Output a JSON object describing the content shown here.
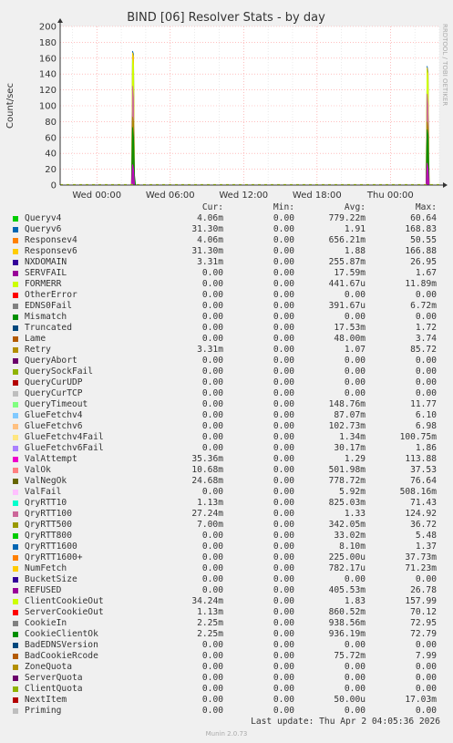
{
  "chart_data": {
    "type": "area",
    "title": "BIND [06] Resolver Stats - by day",
    "ylabel": "Count/sec",
    "side_text": "RRDTOOL / TOBI OETIKER",
    "ylim": [
      0,
      200
    ],
    "yticks": [
      "0",
      "20",
      "40",
      "60",
      "80",
      "100",
      "120",
      "140",
      "160",
      "180",
      "200"
    ],
    "x_range": [
      "2026-03-31 21:00",
      "2026-04-02 04:00"
    ],
    "xticks": [
      {
        "label": "Wed 00:00",
        "time": "2026-04-01 00:00"
      },
      {
        "label": "Wed 06:00",
        "time": "2026-04-01 06:00"
      },
      {
        "label": "Wed 12:00",
        "time": "2026-04-01 12:00"
      },
      {
        "label": "Wed 18:00",
        "time": "2026-04-01 18:00"
      },
      {
        "label": "Thu 00:00",
        "time": "2026-04-02 00:00"
      }
    ],
    "grid": true,
    "series": [
      {
        "name": "Queryv6",
        "color": "#0066b3",
        "points": [
          [
            "2026-04-01 02:50",
            0
          ],
          [
            "2026-04-01 02:55",
            169
          ],
          [
            "2026-04-01 03:00",
            165
          ],
          [
            "2026-04-01 03:05",
            0
          ],
          [
            "2026-04-02 02:55",
            0
          ],
          [
            "2026-04-02 03:00",
            150
          ],
          [
            "2026-04-02 03:05",
            143
          ],
          [
            "2026-04-02 03:10",
            0
          ]
        ]
      },
      {
        "name": "Responsev6",
        "color": "#ffcc00",
        "points": [
          [
            "2026-04-01 02:50",
            0
          ],
          [
            "2026-04-01 02:55",
            167
          ],
          [
            "2026-04-01 03:00",
            162
          ],
          [
            "2026-04-01 03:05",
            0
          ],
          [
            "2026-04-02 02:55",
            0
          ],
          [
            "2026-04-02 03:00",
            148
          ],
          [
            "2026-04-02 03:05",
            140
          ],
          [
            "2026-04-02 03:10",
            0
          ]
        ]
      },
      {
        "name": "ClientCookieOut",
        "color": "#ccff00",
        "points": [
          [
            "2026-04-01 02:50",
            0
          ],
          [
            "2026-04-01 02:55",
            158
          ],
          [
            "2026-04-01 03:00",
            150
          ],
          [
            "2026-04-01 03:05",
            0
          ],
          [
            "2026-04-02 02:55",
            0
          ],
          [
            "2026-04-02 03:00",
            145
          ],
          [
            "2026-04-02 03:05",
            130
          ],
          [
            "2026-04-02 03:10",
            0
          ]
        ]
      },
      {
        "name": "QryRTT100",
        "color": "#cc6699",
        "points": [
          [
            "2026-04-01 02:50",
            0
          ],
          [
            "2026-04-01 02:55",
            125
          ],
          [
            "2026-04-01 03:00",
            110
          ],
          [
            "2026-04-01 03:05",
            0
          ],
          [
            "2026-04-02 02:55",
            0
          ],
          [
            "2026-04-02 03:00",
            115
          ],
          [
            "2026-04-02 03:05",
            100
          ],
          [
            "2026-04-02 03:10",
            0
          ]
        ]
      },
      {
        "name": "Retry",
        "color": "#aa8800",
        "points": [
          [
            "2026-04-01 02:50",
            0
          ],
          [
            "2026-04-01 02:55",
            86
          ],
          [
            "2026-04-01 03:00",
            80
          ],
          [
            "2026-04-01 03:05",
            0
          ],
          [
            "2026-04-02 02:55",
            0
          ],
          [
            "2026-04-02 03:00",
            80
          ],
          [
            "2026-04-02 03:05",
            70
          ],
          [
            "2026-04-02 03:10",
            0
          ]
        ]
      },
      {
        "name": "CookieIn",
        "color": "#008f00",
        "points": [
          [
            "2026-04-01 02:50",
            0
          ],
          [
            "2026-04-01 02:55",
            73
          ],
          [
            "2026-04-01 03:00",
            60
          ],
          [
            "2026-04-01 03:05",
            12
          ],
          [
            "2026-04-01 03:10",
            0
          ],
          [
            "2026-04-02 02:55",
            0
          ],
          [
            "2026-04-02 03:00",
            70
          ],
          [
            "2026-04-02 03:05",
            62
          ],
          [
            "2026-04-02 03:10",
            0
          ]
        ]
      },
      {
        "name": "ValAttempt",
        "color": "#cc00cc",
        "points": [
          [
            "2026-04-01 02:50",
            0
          ],
          [
            "2026-04-01 02:55",
            26
          ],
          [
            "2026-04-01 03:00",
            20
          ],
          [
            "2026-04-01 03:05",
            0
          ],
          [
            "2026-04-02 02:55",
            0
          ],
          [
            "2026-04-02 03:00",
            28
          ],
          [
            "2026-04-02 03:05",
            20
          ],
          [
            "2026-04-02 03:10",
            0
          ]
        ]
      }
    ],
    "legend_columns": [
      "Cur:",
      "Min:",
      "Avg:",
      "Max:"
    ],
    "legend": [
      {
        "name": "Queryv4",
        "color": "#00cc00",
        "cur": "4.06m",
        "min": "0.00",
        "avg": "779.22m",
        "max": "60.64"
      },
      {
        "name": "Queryv6",
        "color": "#0066b3",
        "cur": "31.30m",
        "min": "0.00",
        "avg": "1.91",
        "max": "168.83"
      },
      {
        "name": "Responsev4",
        "color": "#ff8000",
        "cur": "4.06m",
        "min": "0.00",
        "avg": "656.21m",
        "max": "50.55"
      },
      {
        "name": "Responsev6",
        "color": "#ffcc00",
        "cur": "31.30m",
        "min": "0.00",
        "avg": "1.88",
        "max": "166.88"
      },
      {
        "name": "NXDOMAIN",
        "color": "#330099",
        "cur": "3.31m",
        "min": "0.00",
        "avg": "255.87m",
        "max": "26.95"
      },
      {
        "name": "SERVFAIL",
        "color": "#990099",
        "cur": "0.00",
        "min": "0.00",
        "avg": "17.59m",
        "max": "1.67"
      },
      {
        "name": "FORMERR",
        "color": "#ccff00",
        "cur": "0.00",
        "min": "0.00",
        "avg": "441.67u",
        "max": "11.89m"
      },
      {
        "name": "OtherError",
        "color": "#ff0000",
        "cur": "0.00",
        "min": "0.00",
        "avg": "0.00",
        "max": "0.00"
      },
      {
        "name": "EDNS0Fail",
        "color": "#808080",
        "cur": "0.00",
        "min": "0.00",
        "avg": "391.67u",
        "max": "6.72m"
      },
      {
        "name": "Mismatch",
        "color": "#008f00",
        "cur": "0.00",
        "min": "0.00",
        "avg": "0.00",
        "max": "0.00"
      },
      {
        "name": "Truncated",
        "color": "#00487d",
        "cur": "0.00",
        "min": "0.00",
        "avg": "17.53m",
        "max": "1.72"
      },
      {
        "name": "Lame",
        "color": "#b35a00",
        "cur": "0.00",
        "min": "0.00",
        "avg": "48.00m",
        "max": "3.74"
      },
      {
        "name": "Retry",
        "color": "#b38f00",
        "cur": "3.31m",
        "min": "0.00",
        "avg": "1.07",
        "max": "85.72"
      },
      {
        "name": "QueryAbort",
        "color": "#6b006b",
        "cur": "0.00",
        "min": "0.00",
        "avg": "0.00",
        "max": "0.00"
      },
      {
        "name": "QuerySockFail",
        "color": "#8fb300",
        "cur": "0.00",
        "min": "0.00",
        "avg": "0.00",
        "max": "0.00"
      },
      {
        "name": "QueryCurUDP",
        "color": "#b30000",
        "cur": "0.00",
        "min": "0.00",
        "avg": "0.00",
        "max": "0.00"
      },
      {
        "name": "QueryCurTCP",
        "color": "#bebebe",
        "cur": "0.00",
        "min": "0.00",
        "avg": "0.00",
        "max": "0.00"
      },
      {
        "name": "QueryTimeout",
        "color": "#80ff80",
        "cur": "0.00",
        "min": "0.00",
        "avg": "148.76m",
        "max": "11.77"
      },
      {
        "name": "GlueFetchv4",
        "color": "#80c9ff",
        "cur": "0.00",
        "min": "0.00",
        "avg": "87.07m",
        "max": "6.10"
      },
      {
        "name": "GlueFetchv6",
        "color": "#ffc080",
        "cur": "0.00",
        "min": "0.00",
        "avg": "102.73m",
        "max": "6.98"
      },
      {
        "name": "GlueFetchv4Fail",
        "color": "#ffe680",
        "cur": "0.00",
        "min": "0.00",
        "avg": "1.34m",
        "max": "100.75m"
      },
      {
        "name": "GlueFetchv6Fail",
        "color": "#aa80ff",
        "cur": "0.00",
        "min": "0.00",
        "avg": "30.17m",
        "max": "1.86"
      },
      {
        "name": "ValAttempt",
        "color": "#ee00cc",
        "cur": "35.36m",
        "min": "0.00",
        "avg": "1.29",
        "max": "113.88"
      },
      {
        "name": "ValOk",
        "color": "#ff8080",
        "cur": "10.68m",
        "min": "0.00",
        "avg": "501.98m",
        "max": "37.53"
      },
      {
        "name": "ValNegOk",
        "color": "#666600",
        "cur": "24.68m",
        "min": "0.00",
        "avg": "778.72m",
        "max": "76.64"
      },
      {
        "name": "ValFail",
        "color": "#ffbfff",
        "cur": "0.00",
        "min": "0.00",
        "avg": "5.92m",
        "max": "508.16m"
      },
      {
        "name": "QryRTT10",
        "color": "#00ffcc",
        "cur": "1.13m",
        "min": "0.00",
        "avg": "825.03m",
        "max": "71.43"
      },
      {
        "name": "QryRTT100",
        "color": "#cc6699",
        "cur": "27.24m",
        "min": "0.00",
        "avg": "1.33",
        "max": "124.92"
      },
      {
        "name": "QryRTT500",
        "color": "#999900",
        "cur": "7.00m",
        "min": "0.00",
        "avg": "342.05m",
        "max": "36.72"
      },
      {
        "name": "QryRTT800",
        "color": "#00cc00",
        "cur": "0.00",
        "min": "0.00",
        "avg": "33.02m",
        "max": "5.48"
      },
      {
        "name": "QryRTT1600",
        "color": "#0066b3",
        "cur": "0.00",
        "min": "0.00",
        "avg": "8.10m",
        "max": "1.37"
      },
      {
        "name": "QryRTT1600+",
        "color": "#ff8000",
        "cur": "0.00",
        "min": "0.00",
        "avg": "225.00u",
        "max": "37.73m"
      },
      {
        "name": "NumFetch",
        "color": "#ffcc00",
        "cur": "0.00",
        "min": "0.00",
        "avg": "782.17u",
        "max": "71.23m"
      },
      {
        "name": "BucketSize",
        "color": "#330099",
        "cur": "0.00",
        "min": "0.00",
        "avg": "0.00",
        "max": "0.00"
      },
      {
        "name": "REFUSED",
        "color": "#990099",
        "cur": "0.00",
        "min": "0.00",
        "avg": "405.53m",
        "max": "26.78"
      },
      {
        "name": "ClientCookieOut",
        "color": "#ccff00",
        "cur": "34.24m",
        "min": "0.00",
        "avg": "1.83",
        "max": "157.99"
      },
      {
        "name": "ServerCookieOut",
        "color": "#ff0000",
        "cur": "1.13m",
        "min": "0.00",
        "avg": "860.52m",
        "max": "70.12"
      },
      {
        "name": "CookieIn",
        "color": "#808080",
        "cur": "2.25m",
        "min": "0.00",
        "avg": "938.56m",
        "max": "72.95"
      },
      {
        "name": "CookieClientOk",
        "color": "#008f00",
        "cur": "2.25m",
        "min": "0.00",
        "avg": "936.19m",
        "max": "72.79"
      },
      {
        "name": "BadEDNSVersion",
        "color": "#00487d",
        "cur": "0.00",
        "min": "0.00",
        "avg": "0.00",
        "max": "0.00"
      },
      {
        "name": "BadCookieRcode",
        "color": "#b35a00",
        "cur": "0.00",
        "min": "0.00",
        "avg": "75.72m",
        "max": "7.99"
      },
      {
        "name": "ZoneQuota",
        "color": "#b38f00",
        "cur": "0.00",
        "min": "0.00",
        "avg": "0.00",
        "max": "0.00"
      },
      {
        "name": "ServerQuota",
        "color": "#6b006b",
        "cur": "0.00",
        "min": "0.00",
        "avg": "0.00",
        "max": "0.00"
      },
      {
        "name": "ClientQuota",
        "color": "#8fb300",
        "cur": "0.00",
        "min": "0.00",
        "avg": "0.00",
        "max": "0.00"
      },
      {
        "name": "NextItem",
        "color": "#b30000",
        "cur": "0.00",
        "min": "0.00",
        "avg": "50.00u",
        "max": "17.03m"
      },
      {
        "name": "Priming",
        "color": "#bebebe",
        "cur": "0.00",
        "min": "0.00",
        "avg": "0.00",
        "max": "0.00"
      }
    ],
    "last_update": "Last update: Thu Apr  2 04:05:36 2026",
    "credit": "Munin 2.0.73"
  }
}
